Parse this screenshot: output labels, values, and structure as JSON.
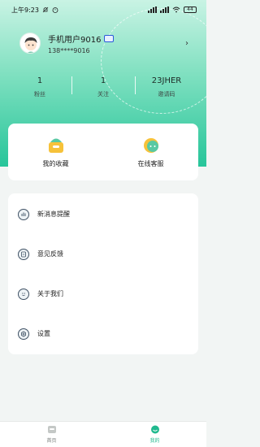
{
  "status_bar": {
    "time": "上午9:23",
    "battery": "44"
  },
  "profile": {
    "username": "手机用户9016",
    "phone": "138****9016",
    "arrow": "›"
  },
  "stats": [
    {
      "value": "1",
      "label": "粉丝"
    },
    {
      "value": "1",
      "label": "关注"
    },
    {
      "value": "23JHER",
      "label": "邀请码"
    }
  ],
  "quick_actions": [
    {
      "label": "我的收藏",
      "icon": "collection-icon"
    },
    {
      "label": "在线客服",
      "icon": "customer-service-icon"
    }
  ],
  "menu": [
    {
      "label": "新消息提醒",
      "icon": "message-alert-icon"
    },
    {
      "label": "意见反馈",
      "icon": "feedback-icon"
    },
    {
      "label": "关于我们",
      "icon": "about-icon"
    },
    {
      "label": "设置",
      "icon": "settings-icon"
    }
  ],
  "tabbar": [
    {
      "label": "首页",
      "icon": "home-icon",
      "active": false
    },
    {
      "label": "我的",
      "icon": "mine-icon",
      "active": true
    }
  ],
  "colors": {
    "accent": "#20b98e",
    "header_top": "#c9f3e4",
    "header_bottom": "#27c59a"
  }
}
